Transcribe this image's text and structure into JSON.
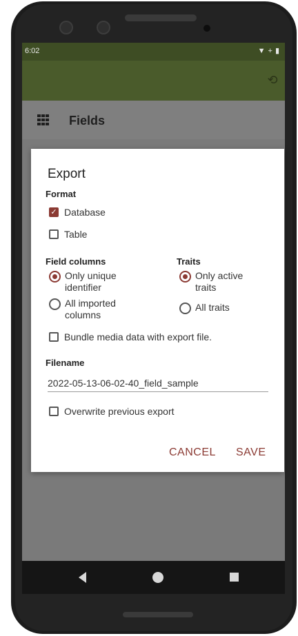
{
  "status_bar": {
    "time": "6:02",
    "icons": [
      "wifi-icon",
      "plus-icon",
      "battery-icon"
    ]
  },
  "app_bar": {
    "history_icon": "history-icon"
  },
  "toolbar": {
    "menu_icon": "grid-icon",
    "title": "Fields"
  },
  "dialog": {
    "title": "Export",
    "format": {
      "label": "Format",
      "options": [
        {
          "label": "Database",
          "checked": true
        },
        {
          "label": "Table",
          "checked": false
        }
      ]
    },
    "field_columns": {
      "label": "Field columns",
      "options": [
        {
          "label": "Only unique identifier",
          "selected": true
        },
        {
          "label": "All imported columns",
          "selected": false
        }
      ]
    },
    "traits": {
      "label": "Traits",
      "options": [
        {
          "label": "Only active traits",
          "selected": true
        },
        {
          "label": "All traits",
          "selected": false
        }
      ]
    },
    "bundle_media": {
      "label": "Bundle media data with export file.",
      "checked": false
    },
    "filename": {
      "label": "Filename",
      "value": "2022-05-13-06-02-40_field_sample"
    },
    "overwrite": {
      "label": "Overwrite previous export",
      "checked": false
    },
    "buttons": {
      "cancel": "CANCEL",
      "save": "SAVE"
    }
  },
  "nav_bar": {
    "back": "back-icon",
    "home": "home-icon",
    "recents": "recents-icon"
  },
  "colors": {
    "app_bar": "#4a5b2b",
    "status_bar": "#3e4d24",
    "accent": "#8b3a33"
  }
}
